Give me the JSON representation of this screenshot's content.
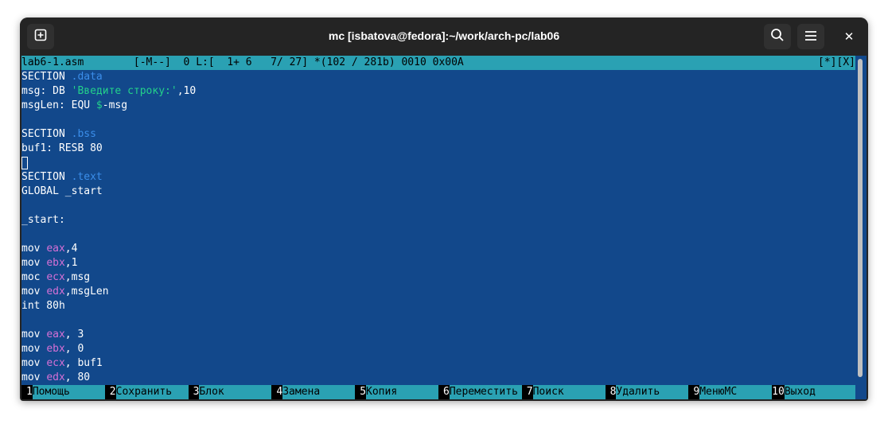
{
  "window": {
    "title": "mc [isbatova@fedora]:~/work/arch-pc/lab06",
    "new_tab_icon": "new-tab-icon",
    "search_icon": "search-icon",
    "menu_icon": "hamburger-menu-icon",
    "close_label": "✕"
  },
  "status": {
    "filename": "lab6-1.asm",
    "mode": "[-M--]",
    "col": "0",
    "line_info": "L:[  1+ 6   7/ 27]",
    "pos_info": "*(102 / 281b) 0010 0x00A",
    "right": "[*][X]"
  },
  "code": [
    [
      [
        "SECTION ",
        "plain"
      ],
      [
        ".data",
        "sec"
      ]
    ],
    [
      [
        "msg: DB ",
        "plain"
      ],
      [
        "'Введите строку:'",
        "str"
      ],
      [
        ",10",
        "plain"
      ]
    ],
    [
      [
        "msgLen: EQU ",
        "plain"
      ],
      [
        "$",
        "dollar"
      ],
      [
        "-msg",
        "plain"
      ]
    ],
    [],
    [
      [
        "SECTION ",
        "plain"
      ],
      [
        ".bss",
        "sec"
      ]
    ],
    [
      [
        "buf1: RESB 80",
        "plain"
      ]
    ],
    [
      [
        "",
        "cursor"
      ]
    ],
    [
      [
        "SECTION ",
        "plain"
      ],
      [
        ".text",
        "sec"
      ]
    ],
    [
      [
        "GLOBAL _start",
        "plain"
      ]
    ],
    [],
    [
      [
        "_start:",
        "plain"
      ]
    ],
    [],
    [
      [
        "mov ",
        "plain"
      ],
      [
        "eax",
        "reg"
      ],
      [
        ",4",
        "plain"
      ]
    ],
    [
      [
        "mov ",
        "plain"
      ],
      [
        "ebx",
        "reg"
      ],
      [
        ",1",
        "plain"
      ]
    ],
    [
      [
        "moc ",
        "plain"
      ],
      [
        "ecx",
        "reg"
      ],
      [
        ",msg",
        "plain"
      ]
    ],
    [
      [
        "mov ",
        "plain"
      ],
      [
        "edx",
        "reg"
      ],
      [
        ",msgLen",
        "plain"
      ]
    ],
    [
      [
        "int 80h",
        "plain"
      ]
    ],
    [],
    [
      [
        "mov ",
        "plain"
      ],
      [
        "eax",
        "reg"
      ],
      [
        ", 3",
        "plain"
      ]
    ],
    [
      [
        "mov ",
        "plain"
      ],
      [
        "ebx",
        "reg"
      ],
      [
        ", 0",
        "plain"
      ]
    ],
    [
      [
        "mov ",
        "plain"
      ],
      [
        "ecx",
        "reg"
      ],
      [
        ", buf1",
        "plain"
      ]
    ],
    [
      [
        "mov ",
        "plain"
      ],
      [
        "edx",
        "reg"
      ],
      [
        ", 80",
        "plain"
      ]
    ]
  ],
  "fkeys": [
    {
      "num": "1",
      "label": "Помощь"
    },
    {
      "num": "2",
      "label": "Сохранить"
    },
    {
      "num": "3",
      "label": "Блок"
    },
    {
      "num": "4",
      "label": "Замена"
    },
    {
      "num": "5",
      "label": "Копия"
    },
    {
      "num": "6",
      "label": "Переместить"
    },
    {
      "num": "7",
      "label": "Поиск"
    },
    {
      "num": "8",
      "label": "Удалить"
    },
    {
      "num": "9",
      "label": "МенюMC"
    },
    {
      "num": "10",
      "label": "Выход"
    }
  ],
  "colors": {
    "terminal_bg": "#12488b",
    "status_bg": "#2aa1b3",
    "section_name": "#3b8eea",
    "string": "#23d18b",
    "register": "#d670d6"
  }
}
